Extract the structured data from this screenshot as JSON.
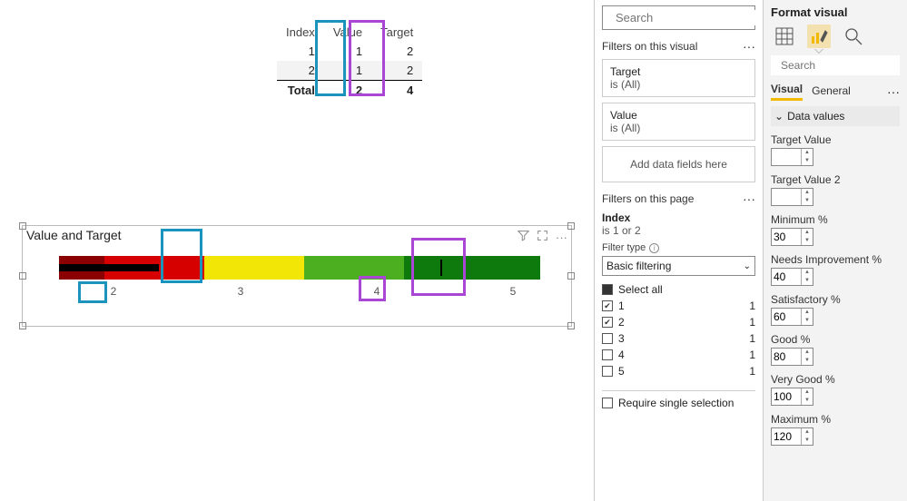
{
  "table": {
    "headers": {
      "index": "Index",
      "value": "Value",
      "target": "Target"
    },
    "rows": [
      {
        "index": "1",
        "value": "1",
        "target": "2"
      },
      {
        "index": "2",
        "value": "1",
        "target": "2"
      }
    ],
    "total_label": "Total",
    "total_value": "2",
    "total_target": "4"
  },
  "bullet": {
    "title": "Value and Target",
    "axis": {
      "a2": "2",
      "a3": "3",
      "a4": "4",
      "a5": "5"
    }
  },
  "filters": {
    "search_placeholder": "Search",
    "sect_visual": "Filters on this visual",
    "cards": [
      {
        "name": "Target",
        "state": "is (All)"
      },
      {
        "name": "Value",
        "state": "is (All)"
      }
    ],
    "drop_hint": "Add data fields here",
    "sect_page": "Filters on this page",
    "page_filter": {
      "name": "Index",
      "state": "is 1 or 2",
      "type_label": "Filter type",
      "type_value": "Basic filtering",
      "select_all": "Select all",
      "items": [
        {
          "label": "1",
          "count": "1",
          "checked": true
        },
        {
          "label": "2",
          "count": "1",
          "checked": true
        },
        {
          "label": "3",
          "count": "1",
          "checked": false
        },
        {
          "label": "4",
          "count": "1",
          "checked": false
        },
        {
          "label": "5",
          "count": "1",
          "checked": false
        }
      ],
      "require_single": "Require single selection"
    }
  },
  "format": {
    "title": "Format visual",
    "search_placeholder": "Search",
    "tabs": {
      "visual": "Visual",
      "general": "General"
    },
    "section": "Data values",
    "props": {
      "target_value": {
        "label": "Target Value",
        "value": ""
      },
      "target_value_2": {
        "label": "Target Value 2",
        "value": ""
      },
      "minimum": {
        "label": "Minimum %",
        "value": "30"
      },
      "needs_imp": {
        "label": "Needs Improvement %",
        "value": "40"
      },
      "satisfactory": {
        "label": "Satisfactory %",
        "value": "60"
      },
      "good": {
        "label": "Good %",
        "value": "80"
      },
      "very_good": {
        "label": "Very Good %",
        "value": "100"
      },
      "maximum": {
        "label": "Maximum %",
        "value": "120"
      }
    }
  },
  "chart_data": {
    "type": "table",
    "columns": [
      "Index",
      "Value",
      "Target"
    ],
    "rows": [
      [
        1,
        1,
        2
      ],
      [
        2,
        1,
        2
      ]
    ],
    "totals": {
      "Value": 2,
      "Target": 4
    },
    "bullet_chart": {
      "title": "Value and Target",
      "value": 2,
      "target": 4,
      "axis_ticks": [
        2,
        3,
        4,
        5
      ],
      "bands": [
        {
          "name": "Minimum",
          "color": "#8b0000"
        },
        {
          "name": "Needs Improvement",
          "color": "#d60000"
        },
        {
          "name": "Satisfactory",
          "color": "#f2e607"
        },
        {
          "name": "Good",
          "color": "#4caf20"
        },
        {
          "name": "Very Good",
          "color": "#0e7a0d"
        }
      ],
      "band_percents": {
        "minimum": 30,
        "needs_improvement": 40,
        "satisfactory": 60,
        "good": 80,
        "very_good": 100,
        "maximum": 120
      }
    }
  }
}
